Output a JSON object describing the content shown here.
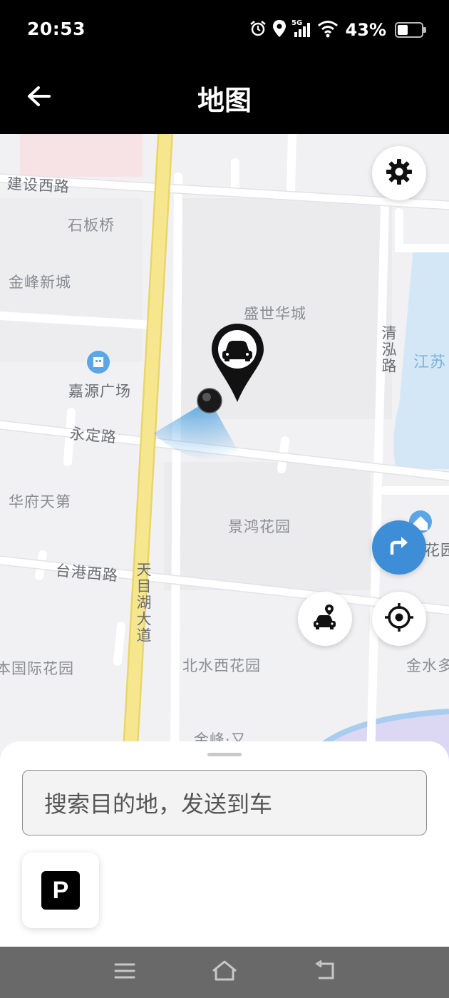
{
  "status_bar": {
    "time": "20:53",
    "network": "5G",
    "battery_percent": "43%",
    "battery_level": 0.43,
    "icons": [
      "alarm-icon",
      "location-icon",
      "signal-icon",
      "wifi-icon",
      "battery-icon"
    ]
  },
  "header": {
    "title": "地图",
    "back_icon": "arrow-left-icon"
  },
  "map": {
    "labels": {
      "jianshe_road": "建设西路",
      "shibanqiao": "石板桥",
      "jinfeng_xincheng": "金峰新城",
      "shengshi_huacheng": "盛世华城",
      "jiayuan_plaza": "嘉源广场",
      "yongding_road": "永定路",
      "qinghong_road": "清泓路",
      "jiangsu": "江苏",
      "huafu_tiandi": "华府天第",
      "jinghong_garden": "景鸿花园",
      "hua_garden_partial": "花园",
      "taigang_road": "台港西路",
      "tianmuhu_avenue": "天目湖大道",
      "international_garden": "本国际花园",
      "beishui_garden": "北水西花园",
      "jinshui_partial": "金水多",
      "jinfeng_bottom": "金峰·又"
    },
    "controls": {
      "settings_icon": "gear-icon",
      "navigate_icon": "turn-right-icon",
      "car_location_icon": "car-pin-icon",
      "my_location_icon": "crosshair-icon"
    },
    "markers": {
      "car_marker_icon": "car-icon",
      "my_location_marker": "location-dot"
    }
  },
  "bottom_sheet": {
    "search_placeholder": "搜索目的地，发送到车",
    "parking_label": "P",
    "parking_icon": "parking-icon"
  },
  "nav_bar": {
    "icons": [
      "menu-icon",
      "home-icon",
      "back-icon"
    ]
  },
  "colors": {
    "accent_blue": "#3d8ed6",
    "main_road_yellow": "#f6e78f",
    "water": "#d4e7f7",
    "header_bg": "#000000"
  }
}
